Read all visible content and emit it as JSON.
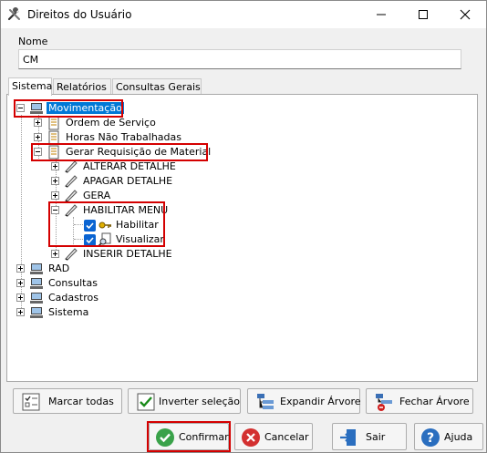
{
  "window": {
    "title": "Direitos do Usuário"
  },
  "name_field": {
    "label": "Nome",
    "value": "CM"
  },
  "tabs": [
    {
      "label": "Sistema",
      "active": true
    },
    {
      "label": "Relatórios",
      "active": false
    },
    {
      "label": "Consultas Gerais",
      "active": false
    }
  ],
  "tree": {
    "movimentacao": "Movimentação",
    "ordem_servico": "Ordem de Serviço",
    "horas_nao_trabalhadas": "Horas Não Trabalhadas",
    "gerar_requisicao": "Gerar Requisição de Material",
    "alterar_detalhe": "ALTERAR DETALHE",
    "apagar_detalhe": "APAGAR DETALHE",
    "gera": "GERA",
    "habilitar_menu": "HABILITAR MENU",
    "habilitar": "Habilitar",
    "visualizar": "Visualizar",
    "inserir_detalhe": "INSERIR DETALHE",
    "rad": "RAD",
    "consultas": "Consultas",
    "cadastros": "Cadastros",
    "sistema": "Sistema"
  },
  "tree_buttons": {
    "marcar_todas": "Marcar todas",
    "inverter_selecao": "Inverter seleção",
    "expandir_arvore": "Expandir Árvore",
    "fechar_arvore": "Fechar Árvore"
  },
  "footer_buttons": {
    "confirmar": "Confirmar",
    "cancelar": "Cancelar",
    "sair": "Sair",
    "ajuda": "Ajuda"
  },
  "colors": {
    "highlight": "#d40000",
    "selection": "#0078d7",
    "checkbox": "#0a64d2"
  },
  "icons": {
    "app": "tools-icon",
    "module": "computer-icon",
    "form": "document-icon",
    "action": "pencil-icon",
    "key": "key-icon",
    "view": "magnifier-doc-icon"
  }
}
